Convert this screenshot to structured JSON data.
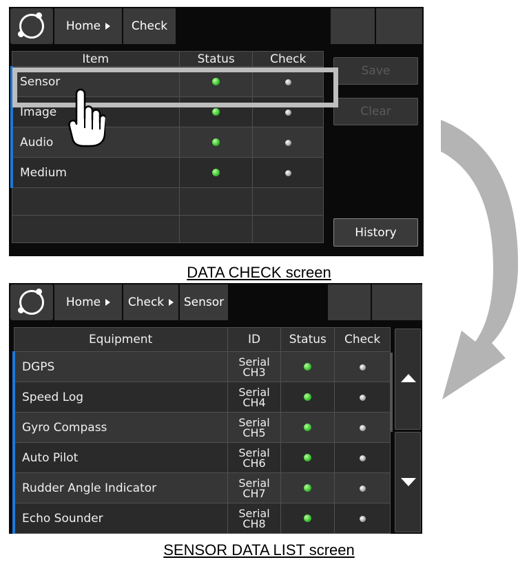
{
  "screen1": {
    "breadcrumbs": [
      "Home",
      "Check"
    ],
    "columns": [
      "Item",
      "Status",
      "Check"
    ],
    "rows": [
      {
        "item": "Sensor"
      },
      {
        "item": "Image"
      },
      {
        "item": "Audio"
      },
      {
        "item": "Medium"
      }
    ],
    "buttons": {
      "save": "Save",
      "clear": "Clear",
      "history": "History"
    },
    "caption": "DATA CHECK screen"
  },
  "screen2": {
    "breadcrumbs": [
      "Home",
      "Check",
      "Sensor"
    ],
    "columns": [
      "Equipment",
      "ID",
      "Status",
      "Check"
    ],
    "rows": [
      {
        "name": "DGPS",
        "id1": "Serial",
        "id2": "CH3"
      },
      {
        "name": "Speed Log",
        "id1": "Serial",
        "id2": "CH4"
      },
      {
        "name": "Gyro Compass",
        "id1": "Serial",
        "id2": "CH5"
      },
      {
        "name": "Auto Pilot",
        "id1": "Serial",
        "id2": "CH6"
      },
      {
        "name": "Rudder Angle Indicator",
        "id1": "Serial",
        "id2": "CH7"
      },
      {
        "name": "Echo Sounder",
        "id1": "Serial",
        "id2": "CH8"
      }
    ],
    "caption": "SENSOR DATA LIST screen"
  },
  "colors": {
    "status_ok": "#39c030",
    "check_idle": "#a8a8a8",
    "row_marker": "#1e78d8",
    "highlight": "#bdbdbd",
    "arrow": "#b4b4b4"
  },
  "icons": [
    "app-logo-icon",
    "chevron-right-icon",
    "pointing-hand-icon",
    "curved-arrow-icon",
    "arrow-up-icon",
    "arrow-down-icon"
  ]
}
